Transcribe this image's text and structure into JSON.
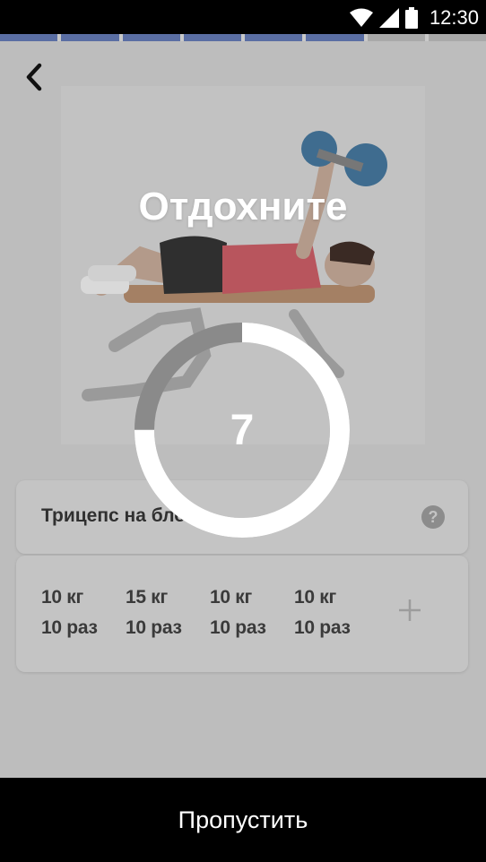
{
  "status_bar": {
    "time": "12:30"
  },
  "workout_progress": {
    "segments_total": 8,
    "segments_done": 6,
    "done_color": "#5a6ea3",
    "pending_color": "#a9a9a9"
  },
  "rest_overlay": {
    "title": "Отдохните",
    "countdown": "7",
    "remaining_fraction": 0.75
  },
  "exercise": {
    "name": "Трицепс на блоке"
  },
  "sets": [
    {
      "weight": "10 кг",
      "reps": "10 раз"
    },
    {
      "weight": "15 кг",
      "reps": "10 раз"
    },
    {
      "weight": "10 кг",
      "reps": "10 раз"
    },
    {
      "weight": "10 кг",
      "reps": "10 раз"
    }
  ],
  "footer": {
    "skip_label": "Пропустить"
  },
  "icons": {
    "back": "back-arrow-icon",
    "help": "help-icon",
    "add": "plus-icon",
    "wifi": "wifi-icon",
    "signal": "signal-icon",
    "battery": "battery-icon"
  }
}
